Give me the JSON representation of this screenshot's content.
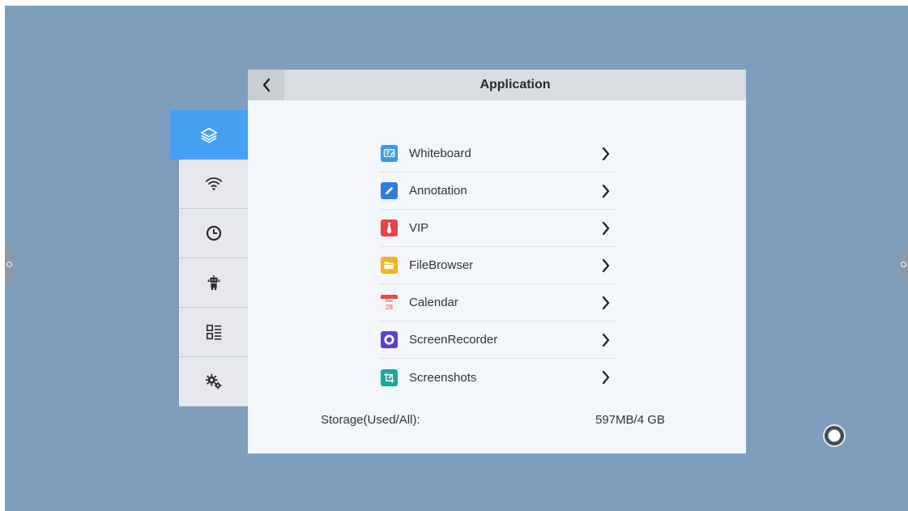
{
  "panel": {
    "title": "Application",
    "back_icon": "chevron-left-icon"
  },
  "sidebar": {
    "items": [
      {
        "name": "layers",
        "icon": "layers-icon",
        "active": true
      },
      {
        "name": "wifi",
        "icon": "wifi-icon",
        "active": false
      },
      {
        "name": "clock",
        "icon": "clock-icon",
        "active": false
      },
      {
        "name": "robot",
        "icon": "robot-icon",
        "active": false
      },
      {
        "name": "list",
        "icon": "list-icon",
        "active": false
      },
      {
        "name": "settings",
        "icon": "gears-icon",
        "active": false
      }
    ]
  },
  "apps": [
    {
      "label": "Whiteboard",
      "icon": "whiteboard-icon",
      "color": "#3b9be6"
    },
    {
      "label": "Annotation",
      "icon": "pen-icon",
      "color": "#2d7de0"
    },
    {
      "label": "VIP",
      "icon": "tie-icon",
      "color": "#e84345"
    },
    {
      "label": "FileBrowser",
      "icon": "folder-icon",
      "color": "#f5b21e"
    },
    {
      "label": "Calendar",
      "icon": "calendar-icon",
      "color": "#f0463c",
      "icon_text": {
        "month": "Dec",
        "day": "28"
      }
    },
    {
      "label": "ScreenRecorder",
      "icon": "record-icon",
      "color": "#5b3fd1"
    },
    {
      "label": "Screenshots",
      "icon": "crop-icon",
      "color": "#19a8a0"
    }
  ],
  "storage": {
    "label": "Storage(Used/All):",
    "value": "597MB/4 GB"
  },
  "colors": {
    "background": "#7f9ebd",
    "accent": "#45a0f2",
    "panel": "#f3f7fb"
  }
}
